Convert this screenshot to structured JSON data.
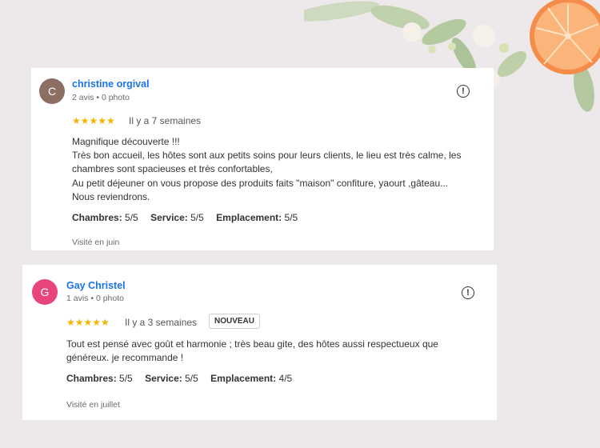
{
  "colors": {
    "background": "#ede8e9",
    "name_link": "#1a73e8",
    "star": "#f4b400",
    "avatar_c": "#8d6e63",
    "avatar_g": "#e8457a"
  },
  "reviews": [
    {
      "avatar_letter": "C",
      "name": "christine orgival",
      "meta": "2 avis • 0 photo",
      "stars": "★★★★★",
      "time": "Il y a 7 semaines",
      "text": "Magnifique découverte !!!\nTrès bon accueil, les hôtes sont aux petits soins pour leurs clients, le lieu est très calme, les chambres sont spacieuses et très confortables,\nAu petit déjeuner on vous propose des produits faits \"maison\" confiture, yaourt ,gâteau...\nNous reviendrons.",
      "ratings": [
        {
          "label": "Chambres:",
          "value": "5/5"
        },
        {
          "label": "Service:",
          "value": "5/5"
        },
        {
          "label": "Emplacement:",
          "value": "5/5"
        }
      ],
      "visited": "Visité en juin",
      "report_icon": "report-flag-icon"
    },
    {
      "avatar_letter": "G",
      "name": "Gay Christel",
      "meta": "1 avis • 0 photo",
      "stars": "★★★★★",
      "time": "Il y a 3 semaines",
      "badge": "NOUVEAU",
      "text": "Tout est pensé avec goût et harmonie ; très beau gite, des hôtes aussi respectueux que généreux. je recommande !",
      "ratings": [
        {
          "label": "Chambres:",
          "value": "5/5"
        },
        {
          "label": "Service:",
          "value": "5/5"
        },
        {
          "label": "Emplacement:",
          "value": "4/5"
        }
      ],
      "visited": "Visité en juillet",
      "report_icon": "report-flag-icon"
    }
  ]
}
